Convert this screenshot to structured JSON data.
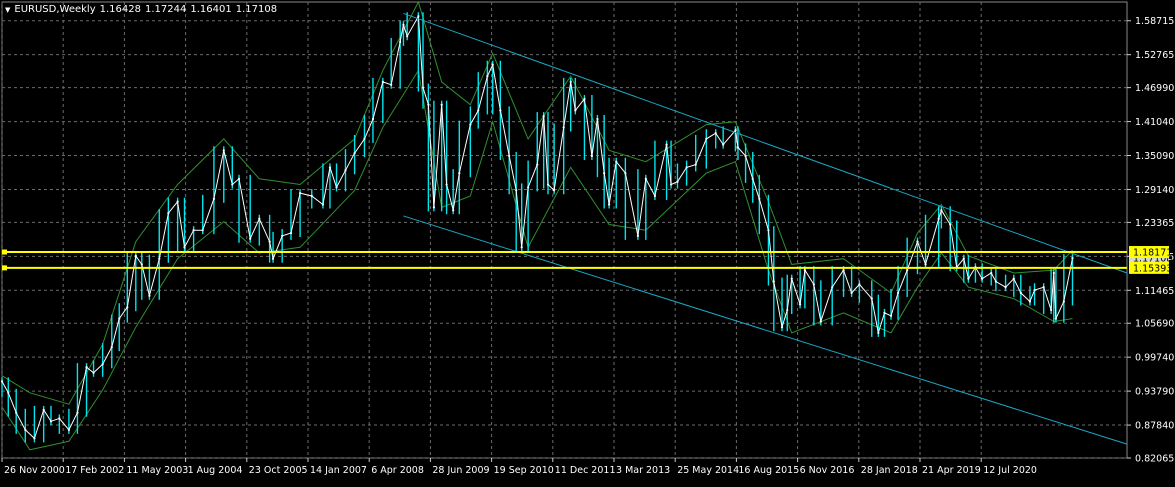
{
  "header": {
    "symbol_label": "EURUSD,Weekly",
    "ohlc": [
      "1.16428",
      "1.17244",
      "1.16401",
      "1.17108"
    ]
  },
  "colors": {
    "background": "#000000",
    "grid": "#6b6b6b",
    "price_line": "#ffffff",
    "price_wick": "#00e5ee",
    "band_line": "#2f8f2f",
    "channel_line": "#1aa7c9",
    "level_line": "#ffff00",
    "axis_text": "#ffffff"
  },
  "chart_data": {
    "type": "line",
    "title": "EURUSD,Weekly",
    "grid": true,
    "y_axis_ticks": [
      "1.58715",
      "1.52765",
      "1.46990",
      "1.41040",
      "1.35090",
      "1.29140",
      "1.23365",
      "1.17415",
      "1.11465",
      "1.05690",
      "0.99740",
      "0.93790",
      "0.87840",
      "0.82065"
    ],
    "x_axis_ticks": [
      "26 Nov 2000",
      "17 Feb 2002",
      "11 May 2003",
      "1 Aug 2004",
      "23 Oct 2005",
      "14 Jan 2007",
      "6 Apr 2008",
      "28 Jun 2009",
      "19 Sep 2010",
      "11 Dec 2011",
      "3 Mar 2013",
      "25 May 2014",
      "16 Aug 2015",
      "6 Nov 2016",
      "28 Jan 2018",
      "21 Apr 2019",
      "12 Jul 2020"
    ],
    "ylim": [
      0.8207,
      1.62
    ],
    "xlim": [
      "2000-11-26",
      "2021-07-12"
    ],
    "series": [
      {
        "name": "EURUSD",
        "points": [
          [
            "2000-11-26",
            0.955
          ],
          [
            "2001-01-07",
            0.935
          ],
          [
            "2001-03-01",
            0.9
          ],
          [
            "2001-05-01",
            0.87
          ],
          [
            "2001-07-01",
            0.855
          ],
          [
            "2001-09-01",
            0.905
          ],
          [
            "2001-10-20",
            0.885
          ],
          [
            "2001-12-15",
            0.89
          ],
          [
            "2002-02-17",
            0.87
          ],
          [
            "2002-04-15",
            0.9
          ],
          [
            "2002-06-15",
            0.98
          ],
          [
            "2002-08-01",
            0.97
          ],
          [
            "2002-10-01",
            0.985
          ],
          [
            "2002-12-01",
            1.015
          ],
          [
            "2003-01-20",
            1.065
          ],
          [
            "2003-03-15",
            1.085
          ],
          [
            "2003-05-11",
            1.175
          ],
          [
            "2003-06-20",
            1.16
          ],
          [
            "2003-08-10",
            1.105
          ],
          [
            "2003-10-15",
            1.17
          ],
          [
            "2003-12-15",
            1.25
          ],
          [
            "2004-02-15",
            1.27
          ],
          [
            "2004-04-01",
            1.19
          ],
          [
            "2004-06-01",
            1.22
          ],
          [
            "2004-08-01",
            1.22
          ],
          [
            "2004-10-15",
            1.275
          ],
          [
            "2004-12-20",
            1.36
          ],
          [
            "2005-02-15",
            1.3
          ],
          [
            "2005-04-01",
            1.31
          ],
          [
            "2005-06-15",
            1.205
          ],
          [
            "2005-08-15",
            1.24
          ],
          [
            "2005-10-23",
            1.2
          ],
          [
            "2005-11-15",
            1.17
          ],
          [
            "2006-01-15",
            1.21
          ],
          [
            "2006-03-15",
            1.215
          ],
          [
            "2006-05-15",
            1.285
          ],
          [
            "2006-08-01",
            1.28
          ],
          [
            "2006-10-15",
            1.265
          ],
          [
            "2006-12-01",
            1.33
          ],
          [
            "2007-01-14",
            1.295
          ],
          [
            "2007-03-15",
            1.325
          ],
          [
            "2007-05-15",
            1.355
          ],
          [
            "2007-07-20",
            1.38
          ],
          [
            "2007-09-15",
            1.415
          ],
          [
            "2007-11-20",
            1.48
          ],
          [
            "2008-01-15",
            1.475
          ],
          [
            "2008-03-15",
            1.55
          ],
          [
            "2008-04-06",
            1.58
          ],
          [
            "2008-05-01",
            1.56
          ],
          [
            "2008-07-15",
            1.595
          ],
          [
            "2008-08-15",
            1.47
          ],
          [
            "2008-09-20",
            1.44
          ],
          [
            "2008-10-27",
            1.26
          ],
          [
            "2008-12-18",
            1.44
          ],
          [
            "2009-01-20",
            1.3
          ],
          [
            "2009-03-05",
            1.255
          ],
          [
            "2009-04-15",
            1.32
          ],
          [
            "2009-06-28",
            1.405
          ],
          [
            "2009-08-20",
            1.43
          ],
          [
            "2009-10-20",
            1.49
          ],
          [
            "2009-11-25",
            1.51
          ],
          [
            "2010-01-15",
            1.43
          ],
          [
            "2010-03-15",
            1.35
          ],
          [
            "2010-05-01",
            1.29
          ],
          [
            "2010-06-07",
            1.19
          ],
          [
            "2010-07-20",
            1.295
          ],
          [
            "2010-09-19",
            1.335
          ],
          [
            "2010-11-01",
            1.42
          ],
          [
            "2010-11-30",
            1.3
          ],
          [
            "2011-01-10",
            1.29
          ],
          [
            "2011-03-15",
            1.4
          ],
          [
            "2011-05-01",
            1.48
          ],
          [
            "2011-06-01",
            1.43
          ],
          [
            "2011-08-01",
            1.45
          ],
          [
            "2011-09-20",
            1.35
          ],
          [
            "2011-10-27",
            1.415
          ],
          [
            "2011-12-11",
            1.32
          ],
          [
            "2012-01-13",
            1.265
          ],
          [
            "2012-03-01",
            1.34
          ],
          [
            "2012-05-01",
            1.32
          ],
          [
            "2012-07-24",
            1.21
          ],
          [
            "2012-09-15",
            1.31
          ],
          [
            "2012-11-15",
            1.28
          ],
          [
            "2013-02-01",
            1.37
          ],
          [
            "2013-03-03",
            1.3
          ],
          [
            "2013-04-15",
            1.305
          ],
          [
            "2013-06-15",
            1.33
          ],
          [
            "2013-08-15",
            1.335
          ],
          [
            "2013-10-25",
            1.38
          ],
          [
            "2013-12-27",
            1.39
          ],
          [
            "2014-02-15",
            1.37
          ],
          [
            "2014-05-08",
            1.395
          ],
          [
            "2014-05-25",
            1.365
          ],
          [
            "2014-07-15",
            1.35
          ],
          [
            "2014-09-01",
            1.31
          ],
          [
            "2014-10-15",
            1.275
          ],
          [
            "2014-12-15",
            1.22
          ],
          [
            "2015-01-20",
            1.13
          ],
          [
            "2015-03-16",
            1.05
          ],
          [
            "2015-04-20",
            1.08
          ],
          [
            "2015-05-20",
            1.135
          ],
          [
            "2015-07-15",
            1.09
          ],
          [
            "2015-08-16",
            1.15
          ],
          [
            "2015-10-15",
            1.125
          ],
          [
            "2015-12-01",
            1.06
          ],
          [
            "2016-02-15",
            1.12
          ],
          [
            "2016-05-01",
            1.15
          ],
          [
            "2016-06-24",
            1.11
          ],
          [
            "2016-08-15",
            1.125
          ],
          [
            "2016-11-06",
            1.1
          ],
          [
            "2016-12-20",
            1.04
          ],
          [
            "2017-01-30",
            1.075
          ],
          [
            "2017-03-15",
            1.07
          ],
          [
            "2017-05-01",
            1.11
          ],
          [
            "2017-07-01",
            1.15
          ],
          [
            "2017-09-08",
            1.2
          ],
          [
            "2017-11-01",
            1.16
          ],
          [
            "2018-01-28",
            1.24
          ],
          [
            "2018-02-15",
            1.255
          ],
          [
            "2018-04-15",
            1.23
          ],
          [
            "2018-05-29",
            1.155
          ],
          [
            "2018-07-15",
            1.17
          ],
          [
            "2018-08-15",
            1.135
          ],
          [
            "2018-10-01",
            1.155
          ],
          [
            "2018-11-15",
            1.135
          ],
          [
            "2019-01-15",
            1.145
          ],
          [
            "2019-02-15",
            1.13
          ],
          [
            "2019-04-21",
            1.12
          ],
          [
            "2019-06-15",
            1.135
          ],
          [
            "2019-08-01",
            1.11
          ],
          [
            "2019-10-01",
            1.095
          ],
          [
            "2019-11-01",
            1.115
          ],
          [
            "2020-01-01",
            1.12
          ],
          [
            "2020-02-20",
            1.08
          ],
          [
            "2020-03-09",
            1.145
          ],
          [
            "2020-03-23",
            1.065
          ],
          [
            "2020-05-15",
            1.095
          ],
          [
            "2020-07-12",
            1.171
          ]
        ]
      }
    ],
    "envelope": {
      "name": "band",
      "upper": [
        [
          "2000-11-26",
          0.965
        ],
        [
          "2001-06-01",
          0.935
        ],
        [
          "2002-02-17",
          0.915
        ],
        [
          "2002-10-01",
          1.02
        ],
        [
          "2003-05-11",
          1.2
        ],
        [
          "2004-02-15",
          1.3
        ],
        [
          "2004-12-20",
          1.38
        ],
        [
          "2005-08-15",
          1.31
        ],
        [
          "2006-05-15",
          1.3
        ],
        [
          "2007-05-15",
          1.38
        ],
        [
          "2007-11-20",
          1.5
        ],
        [
          "2008-07-15",
          1.62
        ],
        [
          "2008-12-18",
          1.48
        ],
        [
          "2009-06-28",
          1.44
        ],
        [
          "2009-11-25",
          1.53
        ],
        [
          "2010-07-20",
          1.38
        ],
        [
          "2011-05-01",
          1.49
        ],
        [
          "2012-01-13",
          1.36
        ],
        [
          "2012-09-15",
          1.34
        ],
        [
          "2013-10-25",
          1.405
        ],
        [
          "2014-05-08",
          1.41
        ],
        [
          "2014-12-15",
          1.27
        ],
        [
          "2015-05-20",
          1.16
        ],
        [
          "2016-05-01",
          1.17
        ],
        [
          "2017-03-15",
          1.11
        ],
        [
          "2017-09-08",
          1.215
        ],
        [
          "2018-02-15",
          1.265
        ],
        [
          "2018-08-15",
          1.175
        ],
        [
          "2019-06-15",
          1.145
        ],
        [
          "2020-03-09",
          1.15
        ],
        [
          "2020-07-12",
          1.185
        ]
      ],
      "lower": [
        [
          "2000-11-26",
          0.91
        ],
        [
          "2001-06-01",
          0.835
        ],
        [
          "2002-02-17",
          0.85
        ],
        [
          "2002-10-01",
          0.94
        ],
        [
          "2003-05-11",
          1.05
        ],
        [
          "2004-02-15",
          1.17
        ],
        [
          "2004-12-20",
          1.235
        ],
        [
          "2005-08-15",
          1.18
        ],
        [
          "2006-05-15",
          1.19
        ],
        [
          "2007-05-15",
          1.29
        ],
        [
          "2007-11-20",
          1.4
        ],
        [
          "2008-07-15",
          1.5
        ],
        [
          "2008-12-18",
          1.26
        ],
        [
          "2009-06-28",
          1.28
        ],
        [
          "2009-11-25",
          1.41
        ],
        [
          "2010-07-20",
          1.19
        ],
        [
          "2011-05-01",
          1.33
        ],
        [
          "2012-01-13",
          1.23
        ],
        [
          "2012-09-15",
          1.22
        ],
        [
          "2013-10-25",
          1.32
        ],
        [
          "2014-05-08",
          1.34
        ],
        [
          "2014-12-15",
          1.15
        ],
        [
          "2015-05-20",
          1.04
        ],
        [
          "2016-05-01",
          1.075
        ],
        [
          "2017-03-15",
          1.04
        ],
        [
          "2017-09-08",
          1.12
        ],
        [
          "2018-02-15",
          1.18
        ],
        [
          "2018-08-15",
          1.12
        ],
        [
          "2019-06-15",
          1.1
        ],
        [
          "2020-03-09",
          1.06
        ],
        [
          "2020-07-12",
          1.065
        ]
      ]
    },
    "trend_lines": [
      {
        "name": "channel-top",
        "from": [
          "2008-04-06",
          1.6
        ],
        "to": [
          "2021-07-12",
          1.145
        ]
      },
      {
        "name": "channel-bottom",
        "from": [
          "2008-04-06",
          1.245
        ],
        "to": [
          "2021-07-12",
          0.845
        ]
      }
    ],
    "levels": [
      {
        "label": "1.18171",
        "value": 1.18171
      },
      {
        "label": "1.15393",
        "value": 1.15393
      },
      {
        "label": "1.17108",
        "value": 1.17108
      }
    ]
  }
}
